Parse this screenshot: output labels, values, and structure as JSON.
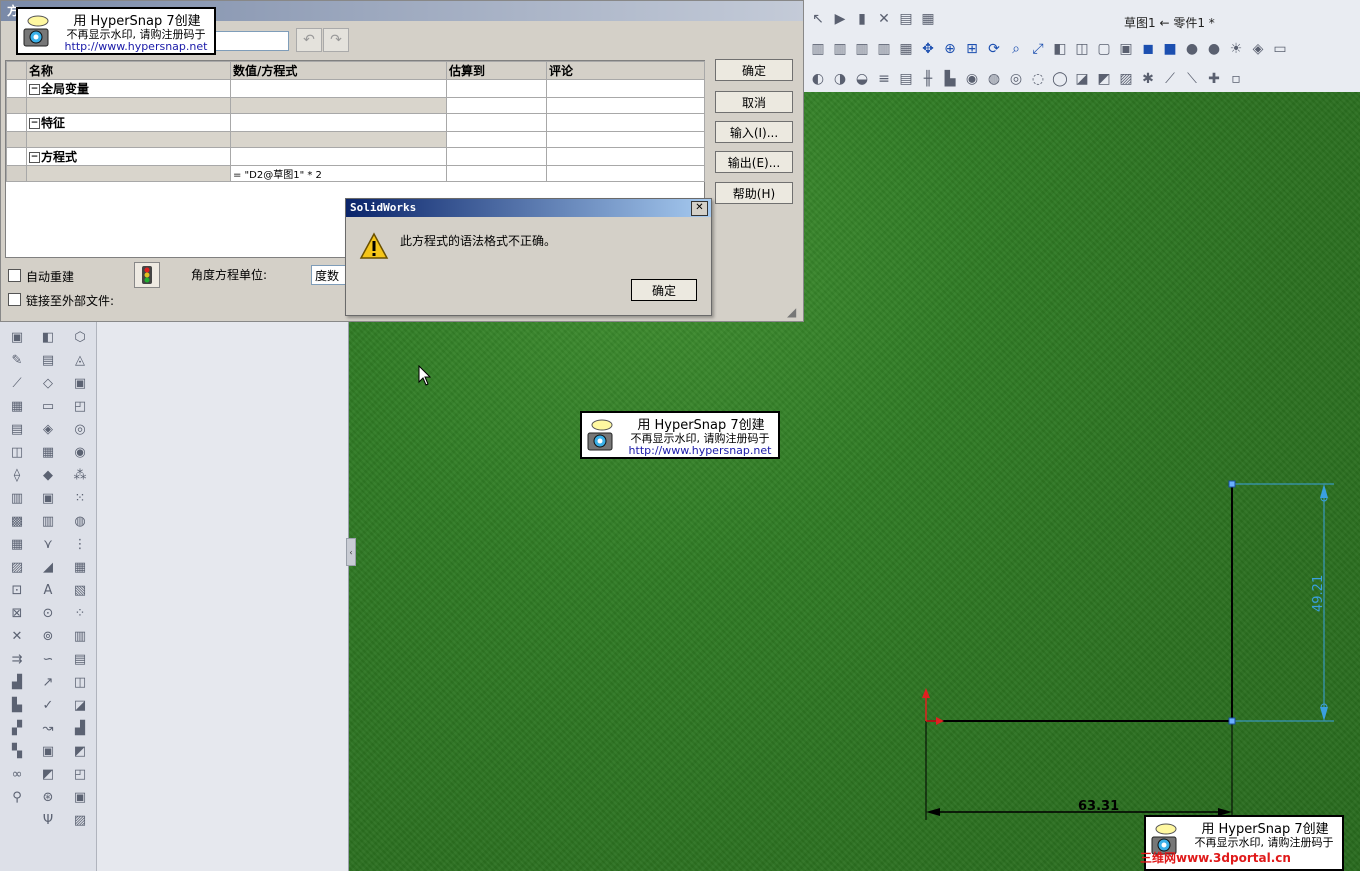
{
  "window": {
    "title": "草图1 ← 零件1 *"
  },
  "equations_dialog": {
    "title": "方",
    "table": {
      "headers": [
        "名称",
        "数值/方程式",
        "估算到",
        "评论"
      ],
      "groups": [
        {
          "label": "全局变量"
        },
        {
          "label": "特征"
        },
        {
          "label": "方程式",
          "equation": "= \"D2@草图1\" * 2"
        }
      ]
    },
    "buttons": {
      "ok": "确定",
      "cancel": "取消",
      "import": "输入(I)...",
      "export": "输出(E)...",
      "help": "帮助(H)"
    },
    "auto_rebuild_label": "自动重建",
    "link_external_label": "链接至外部文件:",
    "angle_unit_label": "角度方程单位:",
    "angle_unit_value": "度数"
  },
  "message_box": {
    "title": "SolidWorks",
    "message": "此方程式的语法格式不正确。",
    "ok_label": "确定",
    "close_glyph": "✕"
  },
  "watermark": {
    "line1": "用 HyperSnap 7创建",
    "line2": "不再显示水印, 请购注册码于",
    "line3": "http://www.hypersnap.net"
  },
  "site_mark": "三维网www.3dportal.cn",
  "sketch": {
    "horizontal_dim": "63.31",
    "vertical_dim": "49.21",
    "dim_color": "#3aa0e0"
  },
  "colors": {
    "viewport_green": "#2f7a22",
    "dialog_gray": "#d4d0c8",
    "msg_title_blue": "#0a246a"
  }
}
